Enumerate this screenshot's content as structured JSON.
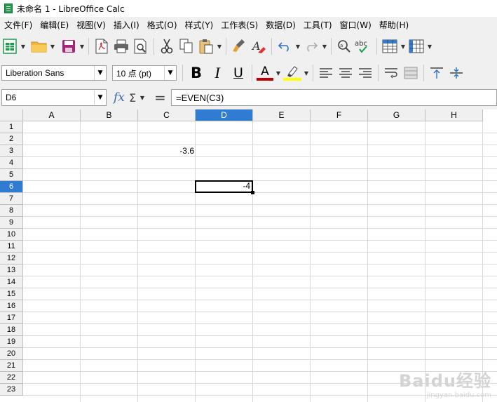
{
  "window": {
    "title": "未命名 1 - LibreOffice Calc"
  },
  "menu": [
    "文件(F)",
    "编辑(E)",
    "视图(V)",
    "插入(I)",
    "格式(O)",
    "样式(Y)",
    "工作表(S)",
    "数据(D)",
    "工具(T)",
    "窗口(W)",
    "帮助(H)"
  ],
  "format": {
    "font_name": "Liberation Sans",
    "font_size": "10 点 (pt)",
    "bold": "B",
    "italic": "I",
    "underline": "U",
    "font_color_letter": "A",
    "font_color": "#c00000",
    "highlight_color": "#ffff00"
  },
  "formula_bar": {
    "cell_ref": "D6",
    "fx": "fx",
    "sigma": "Σ",
    "equals": "=",
    "formula": "=EVEN(C3)"
  },
  "sheet": {
    "columns": [
      "A",
      "B",
      "C",
      "D",
      "E",
      "F",
      "G",
      "H"
    ],
    "rows": [
      "1",
      "2",
      "3",
      "4",
      "5",
      "6",
      "7",
      "8",
      "9",
      "10",
      "11",
      "12",
      "13",
      "14",
      "15",
      "16",
      "17",
      "18",
      "19",
      "20",
      "21",
      "22",
      "23"
    ],
    "active_column": "D",
    "active_row": "6",
    "cells": {
      "C3": "-3.6",
      "D6": "-4"
    }
  },
  "colors": {
    "accent": "#2f7cd2",
    "app_green": "#1e9c4a"
  },
  "watermark": {
    "main": "Baidu经验",
    "sub": "jingyan.baidu.com"
  }
}
